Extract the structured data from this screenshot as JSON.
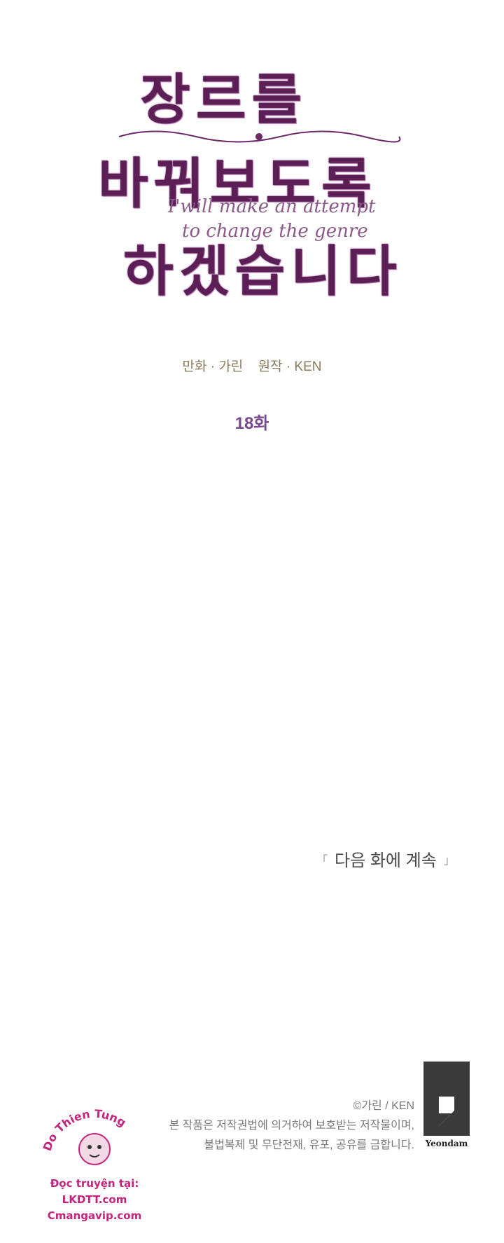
{
  "title": {
    "line1": "장르를",
    "line2": "바꿔보도록",
    "line3": "하겠습니다",
    "english_line1": "I'will make an attempt",
    "english_line2": "to change the genre"
  },
  "credits": {
    "artist": "만화 · 가린",
    "author": "원작 · KEN"
  },
  "episode": "18화",
  "continued": "다음 화에 계속",
  "copyright": {
    "line1": "©가린 / KEN",
    "line2": "본 작품은 저작권법에 의거하여 보호받는 저작물이며,",
    "line3": "불법복제 및 무단전재, 유포, 공유를 금합니다."
  },
  "publisher": {
    "name": "Yeondam"
  },
  "watermark": {
    "arc_text": "Do Thien Tung",
    "line1": "Đọc truyện tại:",
    "line2": "LKDTT.com",
    "line3": "Cmangavip.com"
  },
  "colors": {
    "title": "#5b1f56",
    "episode": "#7a4a8e",
    "credits": "#8a7a5a",
    "watermark": "#c4247e"
  }
}
